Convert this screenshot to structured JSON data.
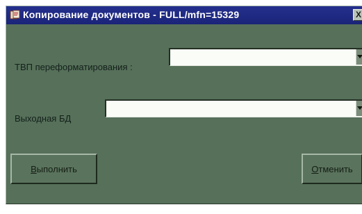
{
  "window": {
    "title": "Копирование документов - FULL/mfn=15329",
    "close_label": "X"
  },
  "form": {
    "reformat_label": "ТВП переформатирования :",
    "reformat_value": "",
    "output_db_label": "Выходная БД",
    "output_db_value": ""
  },
  "buttons": {
    "execute_mnemonic": "В",
    "execute_rest": "ыполнить",
    "cancel_mnemonic": "О",
    "cancel_rest": "тменить"
  },
  "icons": {
    "app": "document-copy-icon",
    "combo_arrow": "chevron-down-icon",
    "close": "close-icon"
  }
}
